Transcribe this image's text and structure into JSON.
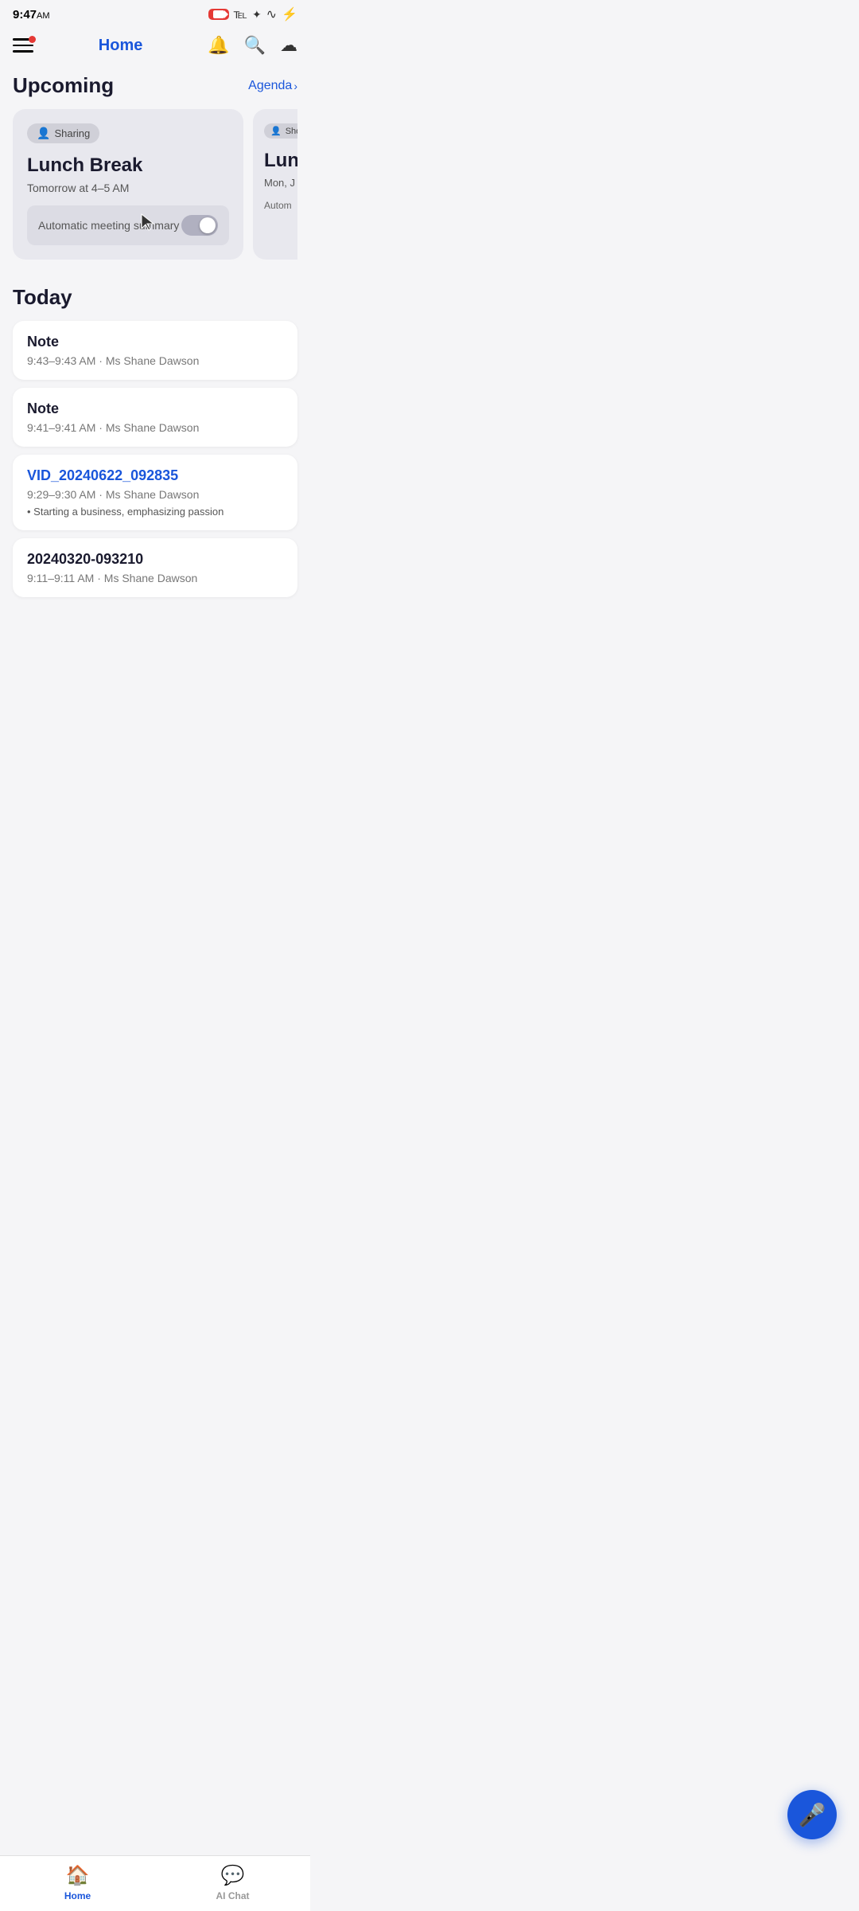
{
  "statusBar": {
    "time": "9:47",
    "ampm": "AM",
    "icons": [
      "camera-recording",
      "bluetooth",
      "location",
      "wifi",
      "battery"
    ]
  },
  "topNav": {
    "title": "Home",
    "hasNotification": true,
    "icons": [
      "bell",
      "search",
      "upload"
    ]
  },
  "upcoming": {
    "sectionTitle": "Upcoming",
    "agendaLink": "Agenda",
    "cards": [
      {
        "badge": "Sharing",
        "title": "Lunch Break",
        "time": "Tomorrow at 4–5 AM",
        "meetingSummaryLabel": "Automatic meeting summary",
        "toggleOn": false
      },
      {
        "badge": "Sharing",
        "title": "Lunc",
        "time": "Mon, J"
      }
    ]
  },
  "today": {
    "sectionTitle": "Today",
    "items": [
      {
        "type": "note",
        "title": "Note",
        "time": "9:43–9:43 AM",
        "person": "Ms Shane Dawson"
      },
      {
        "type": "note",
        "title": "Note",
        "time": "9:41–9:41 AM",
        "person": "Ms Shane Dawson"
      },
      {
        "type": "video",
        "title": "VID_20240622_092835",
        "time": "9:29–9:30 AM",
        "person": "Ms Shane Dawson",
        "bullet": "Starting a business, emphasizing passion"
      },
      {
        "type": "recording",
        "title": "20240320-093210",
        "time": "9:11–9:11 AM",
        "person": "Ms Shane Dawson"
      }
    ]
  },
  "fab": {
    "icon": "microphone"
  },
  "bottomNav": {
    "items": [
      {
        "label": "Home",
        "icon": "home",
        "active": true
      },
      {
        "label": "AI Chat",
        "icon": "chat",
        "active": false
      }
    ]
  },
  "androidNav": {
    "back": "◁",
    "home": "□",
    "menu": "≡"
  }
}
